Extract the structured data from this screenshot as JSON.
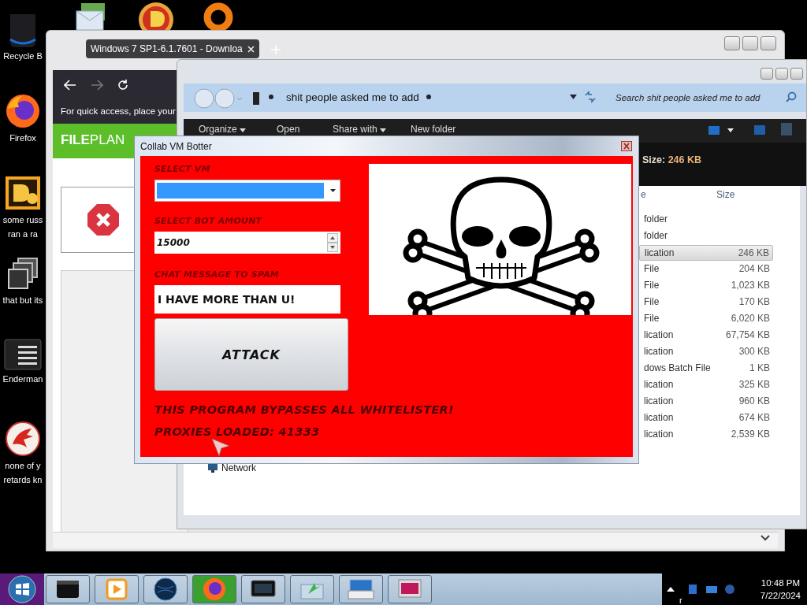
{
  "desktop_icons": [
    {
      "kind": "bin",
      "lines": [
        "Recycle B"
      ]
    },
    {
      "kind": "firefox",
      "lines": [
        "Firefox"
      ]
    },
    {
      "kind": "de",
      "lines": [
        "some russ",
        "ran a ra"
      ]
    },
    {
      "kind": "stack",
      "lines": [
        "that but its"
      ]
    },
    {
      "kind": "terminal",
      "lines": [
        "Enderman"
      ]
    },
    {
      "kind": "dragon",
      "lines": [
        "none of y",
        "retards kn"
      ]
    }
  ],
  "top_icons": [
    {
      "kind": "mail"
    },
    {
      "kind": "badge"
    },
    {
      "kind": "ring"
    }
  ],
  "browser": {
    "tab": {
      "title": "Windows 7 SP1-6.1.7601 - Downloa",
      "selected": true
    },
    "notice": "For quick access, place your",
    "logo": "**FILE**PLAN"
  },
  "explorer": {
    "breadcrumb": "shit people asked me to add",
    "search": {
      "placeholder": "Search shit people asked me to add"
    },
    "toolbar": [
      {
        "label": "Organize",
        "dropdown": true
      },
      {
        "label": "Open",
        "dropdown": false
      },
      {
        "label": "Share with",
        "dropdown": true
      },
      {
        "label": "New folder",
        "dropdown": false
      }
    ],
    "details": {
      "label": "Size:",
      "value": "246 KB"
    },
    "columns": [
      {
        "label": "e"
      },
      {
        "label": "Size"
      }
    ],
    "rows": [
      {
        "type": "folder",
        "selected": false
      },
      {
        "type": "folder",
        "selected": false
      },
      {
        "type": "lication",
        "size": "246 KB",
        "selected": true
      },
      {
        "type": "File",
        "size": "204 KB",
        "selected": false
      },
      {
        "type": "File",
        "size": "1,023 KB",
        "selected": false
      },
      {
        "type": "File",
        "size": "170 KB",
        "selected": false
      },
      {
        "type": "File",
        "size": "6,020 KB",
        "selected": false
      },
      {
        "type": "lication",
        "size": "67,754 KB",
        "selected": false
      },
      {
        "type": "lication",
        "size": "300 KB",
        "selected": false
      },
      {
        "type": "dows Batch File",
        "size": "1 KB",
        "selected": false
      },
      {
        "type": "lication",
        "size": "325 KB",
        "selected": false
      },
      {
        "type": "lication",
        "size": "960 KB",
        "selected": false
      },
      {
        "type": "lication",
        "size": "674 KB",
        "selected": false
      },
      {
        "type": "lication",
        "size": "2,539 KB",
        "selected": false
      }
    ],
    "nav_item": "Network"
  },
  "dialog": {
    "title": "Collab VM Botter",
    "vm": {
      "label": "SELECT VM",
      "highlighted": true
    },
    "bots": {
      "label": "SELECT BOT AMOUNT",
      "value": "15000"
    },
    "message": {
      "label": "CHAT MESSAGE TO SPAM",
      "value": "I HAVE MORE THAN U!"
    },
    "button": "ATTACK",
    "notes": [
      "THIS PROGRAM BYPASSES ALL WHITELISTER!",
      "PROXIES LOADED: 41333"
    ]
  },
  "taskbar": {
    "buttons": [
      {
        "kind": "device",
        "active": false
      },
      {
        "kind": "media",
        "active": false
      },
      {
        "kind": "globe",
        "active": false
      },
      {
        "kind": "firefox",
        "active": true
      },
      {
        "kind": "monitor",
        "active": false
      },
      {
        "kind": "tool",
        "active": false
      },
      {
        "kind": "keyboard",
        "active": false
      },
      {
        "kind": "display",
        "active": false
      }
    ],
    "tray_label": "r",
    "time": "10:48 PM",
    "date": "7/22/2024"
  }
}
